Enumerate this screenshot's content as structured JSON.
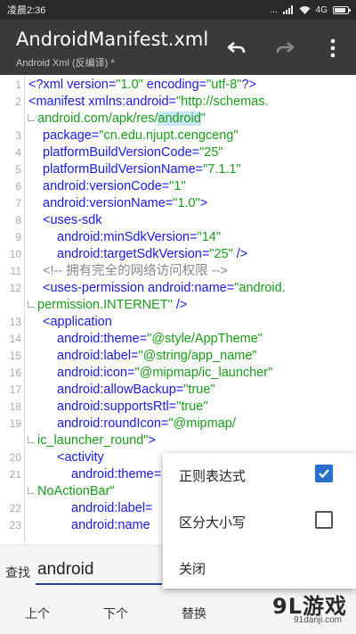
{
  "status_bar": {
    "time": "凌晨2:36",
    "signal": "...",
    "network": "4G"
  },
  "toolbar": {
    "title": "AndroidManifest.xml",
    "subtitle": "Android Xml (反编译) *"
  },
  "icons": {
    "undo": "undo-icon",
    "redo": "redo-icon",
    "more": "more-vert-icon",
    "check": "check-icon"
  },
  "colors": {
    "toolbar_bg": "#3a3a3a",
    "tag": "#1a1ae0",
    "value": "#1a9a1a",
    "comment": "#888888",
    "highlight": "#c9e6f7",
    "checkbox_on": "#2a6fc9"
  },
  "editor": {
    "lines": [
      {
        "n": "1",
        "segs": [
          {
            "t": "<?xml version=",
            "c": "b"
          },
          {
            "t": "\"1.0\"",
            "c": "v"
          },
          {
            "t": " encoding=",
            "c": "b"
          },
          {
            "t": "\"utf-8\"",
            "c": "v"
          },
          {
            "t": "?>",
            "c": "b"
          }
        ]
      },
      {
        "n": "2",
        "segs": [
          {
            "t": "<manifest xmlns:android=",
            "c": "b"
          },
          {
            "t": "\"http://schemas.",
            "c": "v"
          }
        ]
      },
      {
        "n": "",
        "wrap": true,
        "segs": [
          {
            "t": "android.com/apk/res/",
            "c": "v"
          },
          {
            "t": "android",
            "c": "v",
            "hl": true
          },
          {
            "t": "\"",
            "c": "v"
          }
        ]
      },
      {
        "n": "3",
        "indent": 1,
        "segs": [
          {
            "t": "package=",
            "c": "b"
          },
          {
            "t": "\"cn.edu.njupt.cengceng\"",
            "c": "v"
          }
        ]
      },
      {
        "n": "4",
        "indent": 1,
        "segs": [
          {
            "t": "platformBuildVersionCode=",
            "c": "b"
          },
          {
            "t": "\"25\"",
            "c": "v"
          }
        ]
      },
      {
        "n": "5",
        "indent": 1,
        "segs": [
          {
            "t": "platformBuildVersionName=",
            "c": "b"
          },
          {
            "t": "\"7.1.1\"",
            "c": "v"
          }
        ]
      },
      {
        "n": "6",
        "indent": 1,
        "segs": [
          {
            "t": "android:versionCode=",
            "c": "b"
          },
          {
            "t": "\"1\"",
            "c": "v"
          }
        ]
      },
      {
        "n": "7",
        "indent": 1,
        "segs": [
          {
            "t": "android:versionName=",
            "c": "b"
          },
          {
            "t": "\"1.0\"",
            "c": "v"
          },
          {
            "t": ">",
            "c": "b"
          }
        ]
      },
      {
        "n": "8",
        "indent": 1,
        "segs": [
          {
            "t": "<uses-sdk",
            "c": "b"
          }
        ]
      },
      {
        "n": "9",
        "indent": 2,
        "segs": [
          {
            "t": "android:minSdkVersion=",
            "c": "b"
          },
          {
            "t": "\"14\"",
            "c": "v"
          }
        ]
      },
      {
        "n": "10",
        "indent": 2,
        "segs": [
          {
            "t": "android:targetSdkVersion=",
            "c": "b"
          },
          {
            "t": "\"25\"",
            "c": "v"
          },
          {
            "t": " />",
            "c": "b"
          }
        ]
      },
      {
        "n": "11",
        "indent": 1,
        "segs": [
          {
            "t": "<!-- 拥有完全的网络访问权限 -->",
            "c": "c"
          }
        ]
      },
      {
        "n": "12",
        "indent": 1,
        "segs": [
          {
            "t": "<uses-permission android:name=",
            "c": "b"
          },
          {
            "t": "\"android.",
            "c": "v"
          }
        ]
      },
      {
        "n": "",
        "wrap": true,
        "segs": [
          {
            "t": "permission.INTERNET\"",
            "c": "v"
          },
          {
            "t": " />",
            "c": "b"
          }
        ]
      },
      {
        "n": "13",
        "indent": 1,
        "segs": [
          {
            "t": "<application",
            "c": "b"
          }
        ]
      },
      {
        "n": "14",
        "indent": 2,
        "segs": [
          {
            "t": "android:theme=",
            "c": "b"
          },
          {
            "t": "\"@style/AppTheme\"",
            "c": "v"
          }
        ]
      },
      {
        "n": "15",
        "indent": 2,
        "segs": [
          {
            "t": "android:label=",
            "c": "b"
          },
          {
            "t": "\"@string/app_name\"",
            "c": "v"
          }
        ]
      },
      {
        "n": "16",
        "indent": 2,
        "segs": [
          {
            "t": "android:icon=",
            "c": "b"
          },
          {
            "t": "\"@mipmap/ic_launcher\"",
            "c": "v"
          }
        ]
      },
      {
        "n": "17",
        "indent": 2,
        "segs": [
          {
            "t": "android:allowBackup=",
            "c": "b"
          },
          {
            "t": "\"true\"",
            "c": "v"
          }
        ]
      },
      {
        "n": "18",
        "indent": 2,
        "segs": [
          {
            "t": "android:supportsRtl=",
            "c": "b"
          },
          {
            "t": "\"true\"",
            "c": "v"
          }
        ]
      },
      {
        "n": "19",
        "indent": 2,
        "segs": [
          {
            "t": "android:roundIcon=",
            "c": "b"
          },
          {
            "t": "\"@mipmap/",
            "c": "v"
          }
        ]
      },
      {
        "n": "",
        "wrap": true,
        "segs": [
          {
            "t": "ic_launcher_round\"",
            "c": "v"
          },
          {
            "t": ">",
            "c": "b"
          }
        ]
      },
      {
        "n": "20",
        "indent": 2,
        "segs": [
          {
            "t": "<activity",
            "c": "b"
          }
        ]
      },
      {
        "n": "21",
        "indent": 3,
        "segs": [
          {
            "t": "android:theme=",
            "c": "b"
          }
        ]
      },
      {
        "n": "",
        "wrap": true,
        "segs": [
          {
            "t": "NoActionBar\"",
            "c": "v"
          }
        ]
      },
      {
        "n": "22",
        "indent": 3,
        "segs": [
          {
            "t": "android:label=",
            "c": "b"
          }
        ]
      },
      {
        "n": "23",
        "indent": 3,
        "segs": [
          {
            "t": "android:name",
            "c": "b"
          }
        ]
      }
    ]
  },
  "find_bar": {
    "label": "查找",
    "query": "android",
    "prev_label": "上个",
    "next_label": "下个",
    "replace_label": "替换"
  },
  "options_menu": {
    "items": [
      {
        "label": "正则表达式",
        "checked": true
      },
      {
        "label": "区分大小写",
        "checked": false
      },
      {
        "label": "关闭"
      }
    ]
  },
  "watermark": {
    "logo": "9L游戏",
    "url": "91danji.com"
  }
}
